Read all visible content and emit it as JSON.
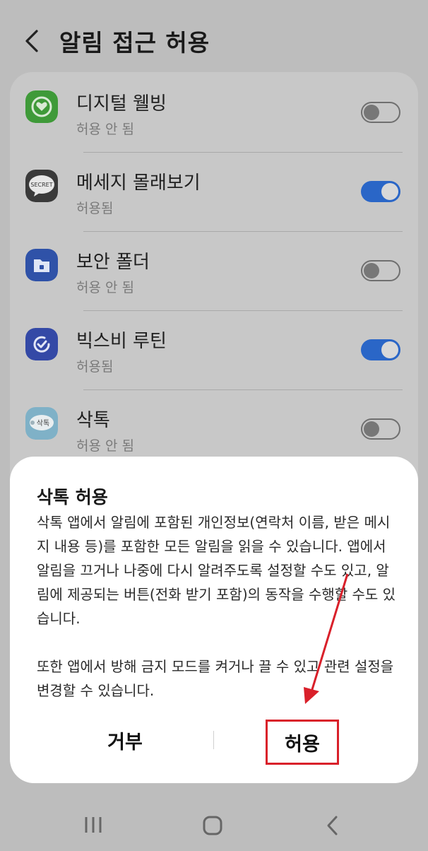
{
  "header": {
    "title": "알림 접근 허용"
  },
  "apps": [
    {
      "name": "디지털 웰빙",
      "status": "허용 안 됨",
      "enabled": false,
      "icon": "digital-wellbeing-icon"
    },
    {
      "name": "메세지 몰래보기",
      "status": "허용됨",
      "enabled": true,
      "icon": "secret-message-icon",
      "icon_text": "SECRET"
    },
    {
      "name": "보안 폴더",
      "status": "허용 안 됨",
      "enabled": false,
      "icon": "secure-folder-icon"
    },
    {
      "name": "빅스비 루틴",
      "status": "허용됨",
      "enabled": true,
      "icon": "bixby-routines-icon"
    },
    {
      "name": "삭톡",
      "status": "허용 안 됨",
      "enabled": false,
      "icon": "saktok-icon",
      "icon_text": "삭톡"
    }
  ],
  "dialog": {
    "title": "삭톡 허용",
    "body": "삭톡 앱에서 알림에 포함된 개인정보(연락처 이름, 받은 메시지 내용 등)를 포함한 모든 알림을 읽을 수 있습니다. 앱에서 알림을 끄거나 나중에 다시 알려주도록 설정할 수도 있고, 알림에 제공되는 버튼(전화 받기 포함)의 동작을 수행할 수도 있습니다.\n\n또한 앱에서 방해 금지 모드를 켜거나 끌 수 있고 관련 설정을 변경할 수 있습니다.",
    "deny_label": "거부",
    "allow_label": "허용"
  },
  "colors": {
    "accent": "#2a66c7",
    "highlight": "#d9202a",
    "dim_background": "#bdbdbd"
  }
}
